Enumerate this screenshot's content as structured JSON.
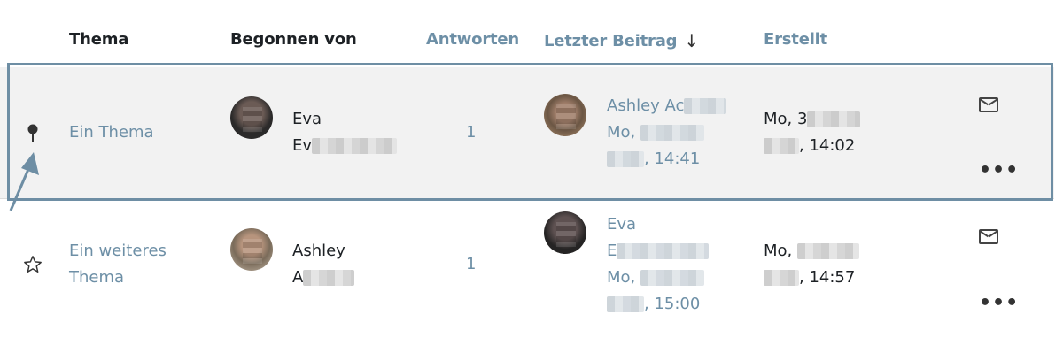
{
  "table": {
    "headers": {
      "thema": "Thema",
      "begonnen_von": "Begonnen von",
      "antworten": "Antworten",
      "letzter_beitrag": "Letzter Beitrag",
      "sort_indicator": "↓",
      "erstellt": "Erstellt"
    },
    "rows": [
      {
        "pinned": true,
        "status_icon": "pin-icon",
        "title": "Ein Thema",
        "started_by_line1": "Eva",
        "started_by_line2": "Ev",
        "replies": "1",
        "last_post_author": "Ashley Ac",
        "last_post_line2": "Mo,",
        "last_post_time": ", 14:41",
        "created_line1": "Mo, 3",
        "created_time": ", 14:02"
      },
      {
        "pinned": false,
        "status_icon": "star-icon",
        "title_line1": "Ein weiteres",
        "title_line2": "Thema",
        "started_by_line1": "Ashley",
        "started_by_line2": "A",
        "replies": "1",
        "last_post_author_line1": "Eva",
        "last_post_author_line2": "E",
        "last_post_line3": "Mo,",
        "last_post_time": ", 15:00",
        "created_line1": "Mo,",
        "created_time": ", 14:57"
      }
    ]
  },
  "colors": {
    "link": "#6d8fa6",
    "highlight_border": "#6e8ea4",
    "row_highlight_bg": "#f2f2f2"
  }
}
